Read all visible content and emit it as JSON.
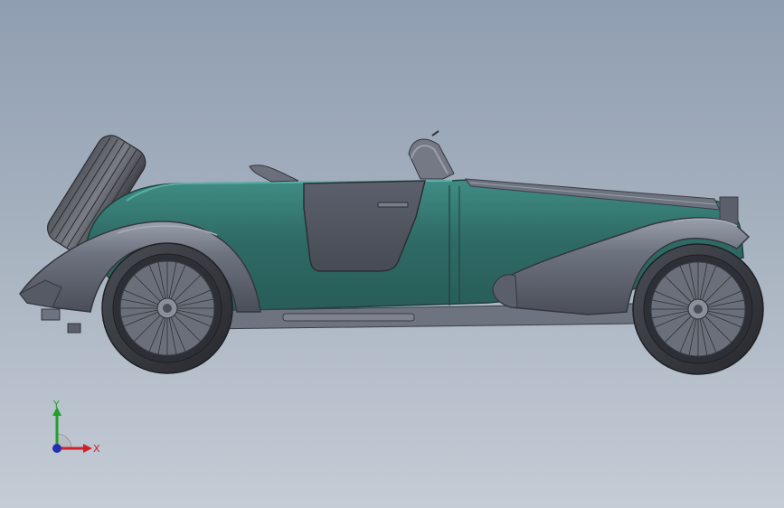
{
  "viewport": {
    "background_top": "#8f9eb1",
    "background_bottom": "#c4ccd5"
  },
  "model": {
    "body_color": "#2f6b66",
    "body_highlight": "#3d8a82",
    "fender_color": "#5a5f6b",
    "fender_highlight": "#8a8f9c",
    "tire_color": "#2e3035",
    "rim_color": "#3c4048"
  },
  "triad": {
    "x_label": "X",
    "y_label": "Y",
    "x_color": "#d0202a",
    "y_color": "#22a02a",
    "z_color": "#2030b0"
  }
}
